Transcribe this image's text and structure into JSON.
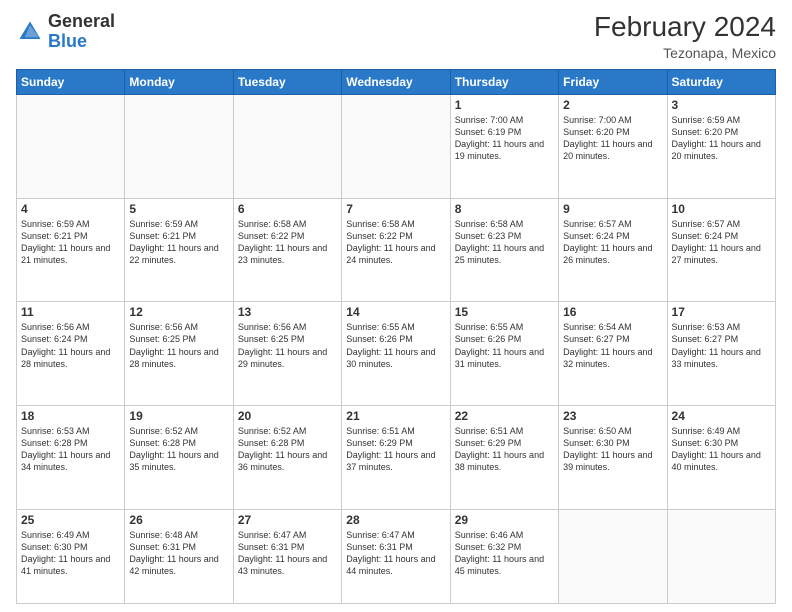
{
  "header": {
    "logo_general": "General",
    "logo_blue": "Blue",
    "month_year": "February 2024",
    "location": "Tezonapa, Mexico"
  },
  "weekdays": [
    "Sunday",
    "Monday",
    "Tuesday",
    "Wednesday",
    "Thursday",
    "Friday",
    "Saturday"
  ],
  "weeks": [
    [
      {
        "day": "",
        "info": ""
      },
      {
        "day": "",
        "info": ""
      },
      {
        "day": "",
        "info": ""
      },
      {
        "day": "",
        "info": ""
      },
      {
        "day": "1",
        "info": "Sunrise: 7:00 AM\nSunset: 6:19 PM\nDaylight: 11 hours and 19 minutes."
      },
      {
        "day": "2",
        "info": "Sunrise: 7:00 AM\nSunset: 6:20 PM\nDaylight: 11 hours and 20 minutes."
      },
      {
        "day": "3",
        "info": "Sunrise: 6:59 AM\nSunset: 6:20 PM\nDaylight: 11 hours and 20 minutes."
      }
    ],
    [
      {
        "day": "4",
        "info": "Sunrise: 6:59 AM\nSunset: 6:21 PM\nDaylight: 11 hours and 21 minutes."
      },
      {
        "day": "5",
        "info": "Sunrise: 6:59 AM\nSunset: 6:21 PM\nDaylight: 11 hours and 22 minutes."
      },
      {
        "day": "6",
        "info": "Sunrise: 6:58 AM\nSunset: 6:22 PM\nDaylight: 11 hours and 23 minutes."
      },
      {
        "day": "7",
        "info": "Sunrise: 6:58 AM\nSunset: 6:22 PM\nDaylight: 11 hours and 24 minutes."
      },
      {
        "day": "8",
        "info": "Sunrise: 6:58 AM\nSunset: 6:23 PM\nDaylight: 11 hours and 25 minutes."
      },
      {
        "day": "9",
        "info": "Sunrise: 6:57 AM\nSunset: 6:24 PM\nDaylight: 11 hours and 26 minutes."
      },
      {
        "day": "10",
        "info": "Sunrise: 6:57 AM\nSunset: 6:24 PM\nDaylight: 11 hours and 27 minutes."
      }
    ],
    [
      {
        "day": "11",
        "info": "Sunrise: 6:56 AM\nSunset: 6:24 PM\nDaylight: 11 hours and 28 minutes."
      },
      {
        "day": "12",
        "info": "Sunrise: 6:56 AM\nSunset: 6:25 PM\nDaylight: 11 hours and 28 minutes."
      },
      {
        "day": "13",
        "info": "Sunrise: 6:56 AM\nSunset: 6:25 PM\nDaylight: 11 hours and 29 minutes."
      },
      {
        "day": "14",
        "info": "Sunrise: 6:55 AM\nSunset: 6:26 PM\nDaylight: 11 hours and 30 minutes."
      },
      {
        "day": "15",
        "info": "Sunrise: 6:55 AM\nSunset: 6:26 PM\nDaylight: 11 hours and 31 minutes."
      },
      {
        "day": "16",
        "info": "Sunrise: 6:54 AM\nSunset: 6:27 PM\nDaylight: 11 hours and 32 minutes."
      },
      {
        "day": "17",
        "info": "Sunrise: 6:53 AM\nSunset: 6:27 PM\nDaylight: 11 hours and 33 minutes."
      }
    ],
    [
      {
        "day": "18",
        "info": "Sunrise: 6:53 AM\nSunset: 6:28 PM\nDaylight: 11 hours and 34 minutes."
      },
      {
        "day": "19",
        "info": "Sunrise: 6:52 AM\nSunset: 6:28 PM\nDaylight: 11 hours and 35 minutes."
      },
      {
        "day": "20",
        "info": "Sunrise: 6:52 AM\nSunset: 6:28 PM\nDaylight: 11 hours and 36 minutes."
      },
      {
        "day": "21",
        "info": "Sunrise: 6:51 AM\nSunset: 6:29 PM\nDaylight: 11 hours and 37 minutes."
      },
      {
        "day": "22",
        "info": "Sunrise: 6:51 AM\nSunset: 6:29 PM\nDaylight: 11 hours and 38 minutes."
      },
      {
        "day": "23",
        "info": "Sunrise: 6:50 AM\nSunset: 6:30 PM\nDaylight: 11 hours and 39 minutes."
      },
      {
        "day": "24",
        "info": "Sunrise: 6:49 AM\nSunset: 6:30 PM\nDaylight: 11 hours and 40 minutes."
      }
    ],
    [
      {
        "day": "25",
        "info": "Sunrise: 6:49 AM\nSunset: 6:30 PM\nDaylight: 11 hours and 41 minutes."
      },
      {
        "day": "26",
        "info": "Sunrise: 6:48 AM\nSunset: 6:31 PM\nDaylight: 11 hours and 42 minutes."
      },
      {
        "day": "27",
        "info": "Sunrise: 6:47 AM\nSunset: 6:31 PM\nDaylight: 11 hours and 43 minutes."
      },
      {
        "day": "28",
        "info": "Sunrise: 6:47 AM\nSunset: 6:31 PM\nDaylight: 11 hours and 44 minutes."
      },
      {
        "day": "29",
        "info": "Sunrise: 6:46 AM\nSunset: 6:32 PM\nDaylight: 11 hours and 45 minutes."
      },
      {
        "day": "",
        "info": ""
      },
      {
        "day": "",
        "info": ""
      }
    ]
  ]
}
